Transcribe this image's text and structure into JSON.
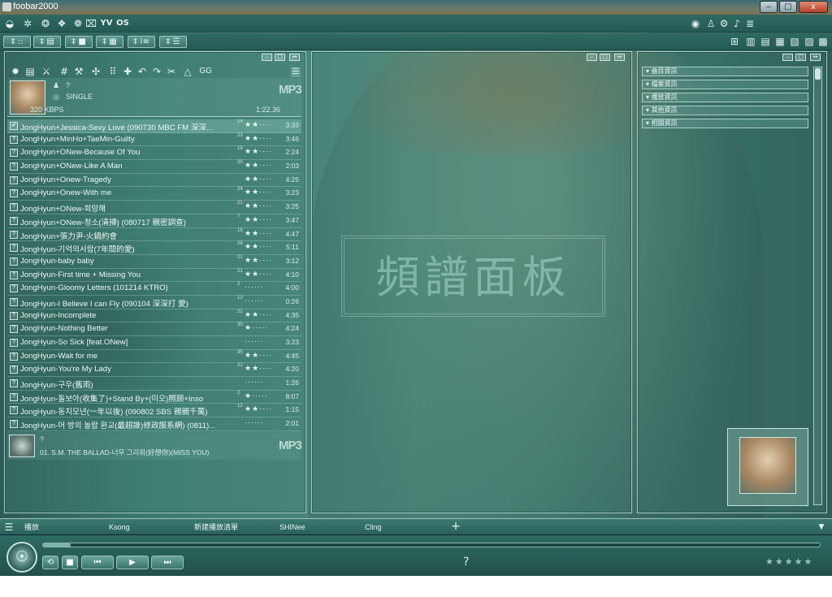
{
  "window": {
    "title": "foobar2000",
    "minimize": "‒",
    "maximize": "□",
    "close": "x"
  },
  "toolbar1": {
    "icons": [
      "disk-icon",
      "atom-icon",
      "circle-icon",
      "fish-icon",
      "circle2-icon",
      "yv-icon",
      "os-icon"
    ],
    "yv_label": "YV",
    "os_label": "OS",
    "right_icons": [
      "search-icon",
      "person-icon",
      "gear-icon",
      "music-icon",
      "list-icon"
    ]
  },
  "toolbar2": {
    "buttons": [
      "‡ ::",
      "‡ ▤",
      "‡ ■",
      "‡ ▦",
      "‡ ⁞≡",
      "‡ ☰"
    ]
  },
  "playlist_panel": {
    "now_playing": {
      "title": "?",
      "album": "SINGLE",
      "bitrate": "320 KBPS",
      "time": "1:22.36",
      "format": "MP3"
    },
    "tracks": [
      {
        "title": "JongHyun+Jessica-Sexy Love (090730 MBC FM 深深...",
        "n": "14",
        "rating": "★★····",
        "dur": "3:33",
        "sel": true
      },
      {
        "title": "JongHyun+MinHo+TaeMin-Guilty",
        "n": "23",
        "rating": "★★····",
        "dur": "3:46"
      },
      {
        "title": "JongHyun+ONew-Because Of You",
        "n": "19",
        "rating": "★★····",
        "dur": "2:24"
      },
      {
        "title": "JongHyun+ONew-Like A Man",
        "n": "20",
        "rating": "★★····",
        "dur": "2:03"
      },
      {
        "title": "JongHyun+Onew-Tragedy",
        "n": "",
        "rating": "★★····",
        "dur": "4:25"
      },
      {
        "title": "JongHyun+Onew-With me",
        "n": "24",
        "rating": "★★····",
        "dur": "3:23"
      },
      {
        "title": "JongHyun+ONew-희망해",
        "n": "21",
        "rating": "★★····",
        "dur": "3:25"
      },
      {
        "title": "JongHyun+ONew-청소(清掃) (080717 親密調查)",
        "n": "7",
        "rating": "★★····",
        "dur": "3:47"
      },
      {
        "title": "JongHyun+張力尹-火鍋約會",
        "n": "15",
        "rating": "★★····",
        "dur": "4:47"
      },
      {
        "title": "JongHyun-기억의서랍(7年間的愛)",
        "n": "26",
        "rating": "★★····",
        "dur": "5:11"
      },
      {
        "title": "JongHyun-baby baby",
        "n": "21",
        "rating": "★★····",
        "dur": "3:12"
      },
      {
        "title": "JongHyun-First time + Missing You",
        "n": "21",
        "rating": "★★····",
        "dur": "4:10"
      },
      {
        "title": "JongHyun-Gloomy Letters (101214 KTRO)",
        "n": "2",
        "rating": "······",
        "dur": "4:00"
      },
      {
        "title": "JongHyun-I Believe I can Fly (090104 深深打 愛)",
        "n": "13",
        "rating": "······",
        "dur": "0:26"
      },
      {
        "title": "JongHyun-Incomplete",
        "n": "22",
        "rating": "★★····",
        "dur": "4:35"
      },
      {
        "title": "JongHyun-Nothing Better",
        "n": "30",
        "rating": "★·····",
        "dur": "4:24"
      },
      {
        "title": "JongHyun-So Sick [feat.ONew]",
        "n": "",
        "rating": "······",
        "dur": "3:23"
      },
      {
        "title": "JongHyun-Wait for me",
        "n": "35",
        "rating": "★★····",
        "dur": "4:45"
      },
      {
        "title": "JongHyun-You're My Lady",
        "n": "21",
        "rating": "★★····",
        "dur": "4:20"
      },
      {
        "title": "JongHyun-구우(舊雨)",
        "n": "",
        "rating": "······",
        "dur": "1:26"
      },
      {
        "title": "JongHyun-돌보아(收集了)+Stand By+(미오)照顾+Inso",
        "n": "2",
        "rating": "★·····",
        "dur": "8:07"
      },
      {
        "title": "JongHyun-동치모년(一年以後) (090802 SBS 親親千萬)",
        "n": "12",
        "rating": "★★····",
        "dur": "1:15"
      },
      {
        "title": "JongHyun-어 방의 놀랍 환교(最超誰)修政服系網) (0811)...",
        "n": "",
        "rating": "······",
        "dur": "2:01"
      }
    ],
    "next_album": {
      "title": "?",
      "artist": "01. S.M. THE BALLAD-너무 그리워(好想你)(MISS YOU)",
      "format": "MP3"
    }
  },
  "spectrum_label": "頻譜面板",
  "right_panel": {
    "sections": [
      "曲目資訊",
      "檔案資訊",
      "播放資訊",
      "其他資訊",
      "相關資訊"
    ]
  },
  "tabs": [
    {
      "label": "播放"
    },
    {
      "label": "Ksong"
    },
    {
      "label": "新建播放清單"
    },
    {
      "label": "SHINee"
    },
    {
      "label": "Cling"
    }
  ],
  "tabs_add": "+",
  "player": {
    "rating": "★★★★★",
    "unknown": "?"
  },
  "colors": {
    "accent": "#3c7a71",
    "border": "#a8cfc6",
    "text": "#eef8f5"
  }
}
